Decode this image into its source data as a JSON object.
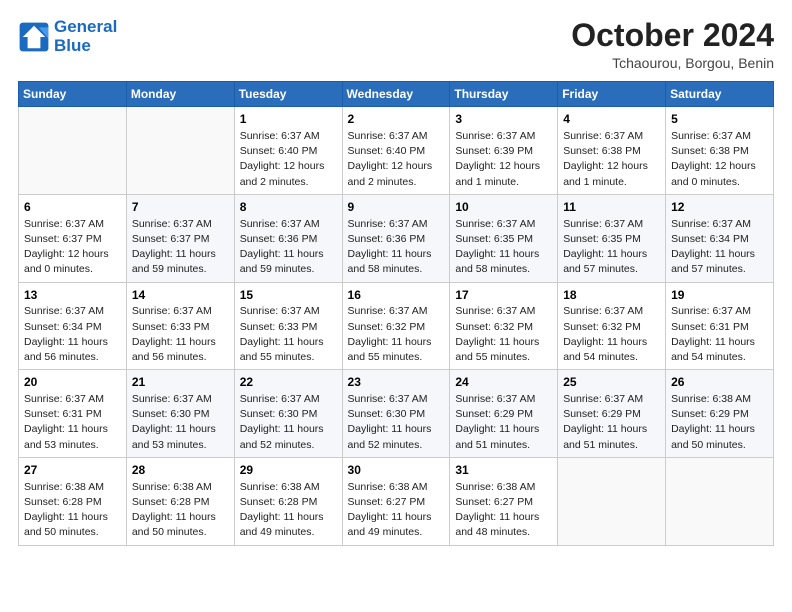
{
  "header": {
    "logo_line1": "General",
    "logo_line2": "Blue",
    "month": "October 2024",
    "location": "Tchaourou, Borgou, Benin"
  },
  "days_of_week": [
    "Sunday",
    "Monday",
    "Tuesday",
    "Wednesday",
    "Thursday",
    "Friday",
    "Saturday"
  ],
  "weeks": [
    [
      {
        "day": "",
        "info": ""
      },
      {
        "day": "",
        "info": ""
      },
      {
        "day": "1",
        "info": "Sunrise: 6:37 AM\nSunset: 6:40 PM\nDaylight: 12 hours and 2 minutes."
      },
      {
        "day": "2",
        "info": "Sunrise: 6:37 AM\nSunset: 6:40 PM\nDaylight: 12 hours and 2 minutes."
      },
      {
        "day": "3",
        "info": "Sunrise: 6:37 AM\nSunset: 6:39 PM\nDaylight: 12 hours and 1 minute."
      },
      {
        "day": "4",
        "info": "Sunrise: 6:37 AM\nSunset: 6:38 PM\nDaylight: 12 hours and 1 minute."
      },
      {
        "day": "5",
        "info": "Sunrise: 6:37 AM\nSunset: 6:38 PM\nDaylight: 12 hours and 0 minutes."
      }
    ],
    [
      {
        "day": "6",
        "info": "Sunrise: 6:37 AM\nSunset: 6:37 PM\nDaylight: 12 hours and 0 minutes."
      },
      {
        "day": "7",
        "info": "Sunrise: 6:37 AM\nSunset: 6:37 PM\nDaylight: 11 hours and 59 minutes."
      },
      {
        "day": "8",
        "info": "Sunrise: 6:37 AM\nSunset: 6:36 PM\nDaylight: 11 hours and 59 minutes."
      },
      {
        "day": "9",
        "info": "Sunrise: 6:37 AM\nSunset: 6:36 PM\nDaylight: 11 hours and 58 minutes."
      },
      {
        "day": "10",
        "info": "Sunrise: 6:37 AM\nSunset: 6:35 PM\nDaylight: 11 hours and 58 minutes."
      },
      {
        "day": "11",
        "info": "Sunrise: 6:37 AM\nSunset: 6:35 PM\nDaylight: 11 hours and 57 minutes."
      },
      {
        "day": "12",
        "info": "Sunrise: 6:37 AM\nSunset: 6:34 PM\nDaylight: 11 hours and 57 minutes."
      }
    ],
    [
      {
        "day": "13",
        "info": "Sunrise: 6:37 AM\nSunset: 6:34 PM\nDaylight: 11 hours and 56 minutes."
      },
      {
        "day": "14",
        "info": "Sunrise: 6:37 AM\nSunset: 6:33 PM\nDaylight: 11 hours and 56 minutes."
      },
      {
        "day": "15",
        "info": "Sunrise: 6:37 AM\nSunset: 6:33 PM\nDaylight: 11 hours and 55 minutes."
      },
      {
        "day": "16",
        "info": "Sunrise: 6:37 AM\nSunset: 6:32 PM\nDaylight: 11 hours and 55 minutes."
      },
      {
        "day": "17",
        "info": "Sunrise: 6:37 AM\nSunset: 6:32 PM\nDaylight: 11 hours and 55 minutes."
      },
      {
        "day": "18",
        "info": "Sunrise: 6:37 AM\nSunset: 6:32 PM\nDaylight: 11 hours and 54 minutes."
      },
      {
        "day": "19",
        "info": "Sunrise: 6:37 AM\nSunset: 6:31 PM\nDaylight: 11 hours and 54 minutes."
      }
    ],
    [
      {
        "day": "20",
        "info": "Sunrise: 6:37 AM\nSunset: 6:31 PM\nDaylight: 11 hours and 53 minutes."
      },
      {
        "day": "21",
        "info": "Sunrise: 6:37 AM\nSunset: 6:30 PM\nDaylight: 11 hours and 53 minutes."
      },
      {
        "day": "22",
        "info": "Sunrise: 6:37 AM\nSunset: 6:30 PM\nDaylight: 11 hours and 52 minutes."
      },
      {
        "day": "23",
        "info": "Sunrise: 6:37 AM\nSunset: 6:30 PM\nDaylight: 11 hours and 52 minutes."
      },
      {
        "day": "24",
        "info": "Sunrise: 6:37 AM\nSunset: 6:29 PM\nDaylight: 11 hours and 51 minutes."
      },
      {
        "day": "25",
        "info": "Sunrise: 6:37 AM\nSunset: 6:29 PM\nDaylight: 11 hours and 51 minutes."
      },
      {
        "day": "26",
        "info": "Sunrise: 6:38 AM\nSunset: 6:29 PM\nDaylight: 11 hours and 50 minutes."
      }
    ],
    [
      {
        "day": "27",
        "info": "Sunrise: 6:38 AM\nSunset: 6:28 PM\nDaylight: 11 hours and 50 minutes."
      },
      {
        "day": "28",
        "info": "Sunrise: 6:38 AM\nSunset: 6:28 PM\nDaylight: 11 hours and 50 minutes."
      },
      {
        "day": "29",
        "info": "Sunrise: 6:38 AM\nSunset: 6:28 PM\nDaylight: 11 hours and 49 minutes."
      },
      {
        "day": "30",
        "info": "Sunrise: 6:38 AM\nSunset: 6:27 PM\nDaylight: 11 hours and 49 minutes."
      },
      {
        "day": "31",
        "info": "Sunrise: 6:38 AM\nSunset: 6:27 PM\nDaylight: 11 hours and 48 minutes."
      },
      {
        "day": "",
        "info": ""
      },
      {
        "day": "",
        "info": ""
      }
    ]
  ]
}
